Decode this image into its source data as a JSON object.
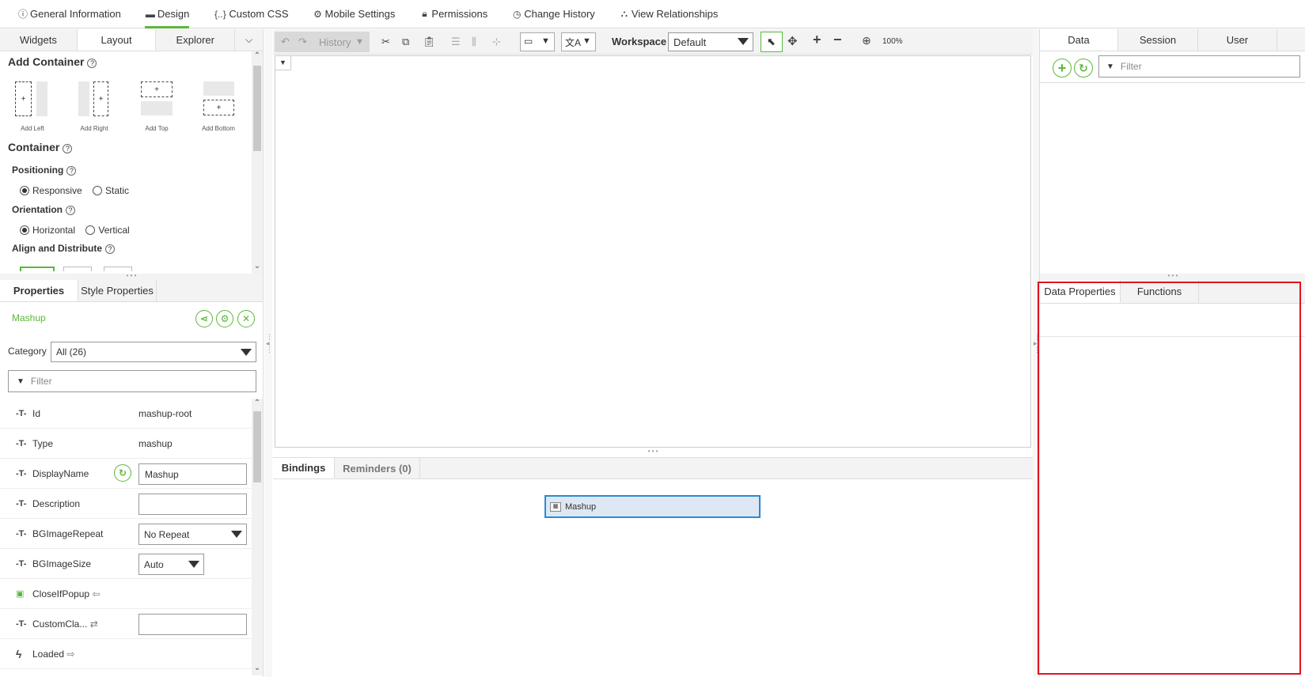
{
  "topnav": {
    "items": [
      {
        "icon": "info-icon",
        "label": "General Information"
      },
      {
        "icon": "design-icon",
        "label": "Design"
      },
      {
        "icon": "css-icon",
        "label": "Custom CSS"
      },
      {
        "icon": "gear-icon",
        "label": "Mobile Settings"
      },
      {
        "icon": "lock-icon",
        "label": "Permissions"
      },
      {
        "icon": "clock-icon",
        "label": "Change History"
      },
      {
        "icon": "relationships-icon",
        "label": "View Relationships"
      }
    ],
    "active": "Design",
    "accent_color": "#5bb73b"
  },
  "left_tabs": [
    "Widgets",
    "Layout",
    "Explorer"
  ],
  "layout_panel": {
    "add_container_title": "Add Container",
    "add_options": [
      "Add Left",
      "Add Right",
      "Add Top",
      "Add Bottom"
    ],
    "container_title": "Container",
    "positioning_label": "Positioning",
    "positioning_options": [
      "Responsive",
      "Static"
    ],
    "positioning_selected": "Responsive",
    "orientation_label": "Orientation",
    "orientation_options": [
      "Horizontal",
      "Vertical"
    ],
    "orientation_selected": "Horizontal",
    "align_label": "Align and Distribute"
  },
  "props_tabs": [
    "Properties",
    "Style Properties"
  ],
  "props": {
    "entity_name": "Mashup",
    "category_label": "Category",
    "category_value": "All (26)",
    "filter_placeholder": "Filter",
    "rows": [
      {
        "name": "Id",
        "value": "mashup-root"
      },
      {
        "name": "Type",
        "value": "mashup"
      },
      {
        "name": "DisplayName",
        "value": "Mashup"
      },
      {
        "name": "Description",
        "value": ""
      },
      {
        "name": "BGImageRepeat",
        "value": "No Repeat"
      },
      {
        "name": "BGImageSize",
        "value": "Auto"
      },
      {
        "name": "CloseIfPopup",
        "value": ""
      },
      {
        "name": "CustomCla...",
        "value": ""
      },
      {
        "name": "Loaded",
        "value": ""
      }
    ]
  },
  "toolbar": {
    "history_label": "History",
    "workspace_label": "Workspace",
    "workspace_value": "Default",
    "zoom": "100%"
  },
  "bindings_tabs": [
    "Bindings",
    "Reminders (0)"
  ],
  "bindings_node": "Mashup",
  "right_tabs": [
    "Data",
    "Session",
    "User"
  ],
  "right_filter_placeholder": "Filter",
  "data_props_tabs": [
    "Data Properties",
    "Functions"
  ]
}
